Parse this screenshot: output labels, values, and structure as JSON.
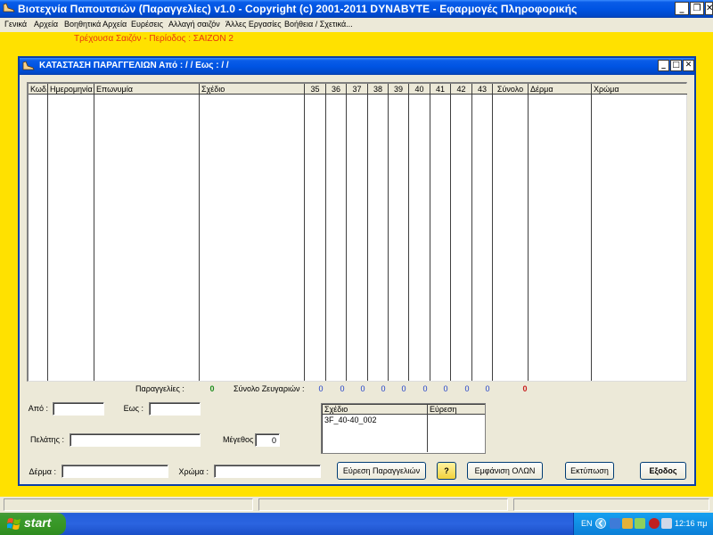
{
  "window": {
    "title": "Βιοτεχνία Παπουτσιών (Παραγγελίες)  v1.0   -   Copyright (c) 2001-2011 DYNABYTE - Εφαρμογές Πληροφορικής",
    "minimize": "_",
    "restore": "❐",
    "close": "✕"
  },
  "menu": [
    "Γενικά",
    "Αρχεία",
    "Βοηθητικά Αρχεία",
    "Ευρέσεις",
    "Αλλαγή σαιζόν",
    "Άλλες Εργασίες",
    "Βοήθεια / Σχετικά..."
  ],
  "season_banner": "Τρέχουσα Σαιζόν - Περίοδος :  ΣΑΙΖΟΝ 2",
  "child": {
    "title": "ΚΑΤΑΣΤΑΣΗ ΠΑΡΑΓΓΕΛΙΩΝ  Από :  / /  Εως :  / /",
    "minimize": "_",
    "maximize": "□",
    "close": "✕"
  },
  "grid": {
    "columns": [
      "Κωδ.",
      "Ημερομηνία",
      "Επωνυμία",
      "Σχέδιο",
      "35",
      "36",
      "37",
      "38",
      "39",
      "40",
      "41",
      "42",
      "43",
      "Σύνολο",
      "Δέρμα",
      "Χρώμα"
    ],
    "rows": []
  },
  "totals": {
    "orders_label": "Παραγγελίες :",
    "orders_count": "0",
    "pairs_label": "Σύνολο Ζευγαριών :",
    "size_totals": [
      "0",
      "0",
      "0",
      "0",
      "0",
      "0",
      "0",
      "0",
      "0"
    ],
    "grand_total": "0"
  },
  "filters": {
    "from_label": "Από :",
    "from_value": "",
    "to_label": "Εως :",
    "to_value": "",
    "customer_label": "Πελάτης :",
    "customer_value": "",
    "size_label": "Μέγεθος :",
    "size_value": "0",
    "leather_label": "Δέρμα :",
    "leather_value": "",
    "color_label": "Χρώμα :",
    "color_value": ""
  },
  "design_list": {
    "columns": [
      "Σχέδιο",
      "Εύρεση"
    ],
    "items": [
      "3F_40-40_002"
    ]
  },
  "buttons": {
    "find_orders": "Εύρεση Παραγγελιών",
    "help": "?",
    "show_all": "Εμφάνιση ΟΛΩΝ",
    "print": "Εκτύπωση",
    "exit": "Εξοδος"
  },
  "taskbar": {
    "start": "start",
    "lang": "EN",
    "clock": "12:16 πμ"
  },
  "colors": {
    "background": "#FFE100",
    "season_text": "#E8360F",
    "total_blue": "#1F3FC8",
    "orders_green": "#1E8C1E",
    "grand_total_red": "#C81E1E"
  }
}
